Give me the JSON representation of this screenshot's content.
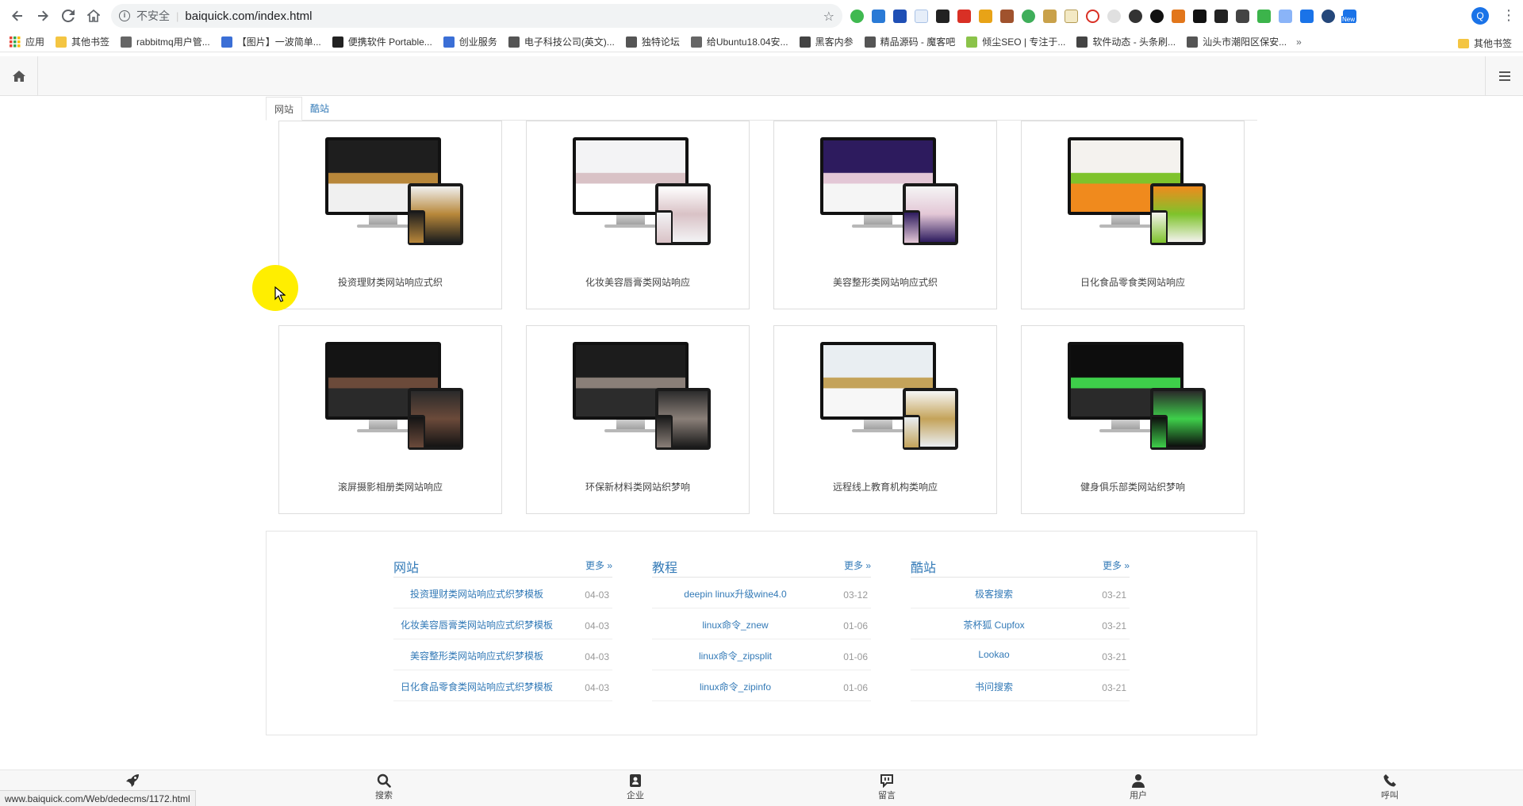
{
  "browser": {
    "insecure_label": "不安全",
    "url": "baiquick.com/index.html",
    "profile_initial": "Q",
    "ext_badge": "New"
  },
  "bookmarks": {
    "items": [
      {
        "label": "应用",
        "color": "#4285f4"
      },
      {
        "label": "其他书签",
        "color": "#f4c542"
      },
      {
        "label": "rabbitmq用户管...",
        "color": "#666666"
      },
      {
        "label": "【图片】一波简单...",
        "color": "#3b6fd6"
      },
      {
        "label": "便携软件 Portable...",
        "color": "#222222"
      },
      {
        "label": "创业服务",
        "color": "#3b6fd6"
      },
      {
        "label": "电子科技公司(英文)...",
        "color": "#555555"
      },
      {
        "label": "独特论坛",
        "color": "#555555"
      },
      {
        "label": "给Ubuntu18.04安...",
        "color": "#666666"
      },
      {
        "label": "黑客内参",
        "color": "#444444"
      },
      {
        "label": "精品源码 - 魔客吧",
        "color": "#555555"
      },
      {
        "label": "倾尘SEO | 专注于...",
        "color": "#8bc34a"
      },
      {
        "label": "软件动态 - 头条刷...",
        "color": "#444444"
      },
      {
        "label": "汕头市潮阳区保安...",
        "color": "#555555"
      }
    ],
    "overflow": "»",
    "right_folder": "其他书签"
  },
  "tabs": [
    {
      "label": "网站",
      "active": true
    },
    {
      "label": "酷站",
      "active": false
    }
  ],
  "cards": [
    {
      "title": "投资理财类网站响应式织",
      "palette": [
        "#1e1e1e",
        "#b8873a",
        "#f0f0f0"
      ]
    },
    {
      "title": "化妆美容唇膏类网站响应",
      "palette": [
        "#f3f3f5",
        "#d9c2c6",
        "#ffffff"
      ]
    },
    {
      "title": "美容整形类网站响应式织",
      "palette": [
        "#2d1b5e",
        "#e3c7d6",
        "#f5f5f5"
      ]
    },
    {
      "title": "日化食品零食类网站响应",
      "palette": [
        "#f4f2ee",
        "#7ec32b",
        "#f08a1d"
      ]
    },
    {
      "title": "滚屏摄影相册类网站响应",
      "palette": [
        "#141414",
        "#6b4a3a",
        "#2a2a2a"
      ]
    },
    {
      "title": "环保新材料类网站织梦响",
      "palette": [
        "#1c1c1c",
        "#8a7f78",
        "#2c2c2c"
      ]
    },
    {
      "title": "远程线上教育机构类响应",
      "palette": [
        "#e9eef2",
        "#c4a35a",
        "#f7f7f7"
      ]
    },
    {
      "title": "健身俱乐部类网站织梦响",
      "palette": [
        "#0d0d0d",
        "#3ecf4a",
        "#2a2a2a"
      ]
    }
  ],
  "lists": [
    {
      "title": "网站",
      "more": "更多 »",
      "items": [
        {
          "text": "投资理财类网站响应式织梦模板",
          "date": "04-03"
        },
        {
          "text": "化妆美容唇膏类网站响应式织梦模板",
          "date": "04-03"
        },
        {
          "text": "美容整形类网站响应式织梦模板",
          "date": "04-03"
        },
        {
          "text": "日化食品零食类网站响应式织梦模板",
          "date": "04-03"
        }
      ]
    },
    {
      "title": "教程",
      "more": "更多 »",
      "items": [
        {
          "text": "deepin linux升级wine4.0",
          "date": "03-12"
        },
        {
          "text": "linux命令_znew",
          "date": "01-06"
        },
        {
          "text": "linux命令_zipsplit",
          "date": "01-06"
        },
        {
          "text": "linux命令_zipinfo",
          "date": "01-06"
        }
      ]
    },
    {
      "title": "酷站",
      "more": "更多 »",
      "items": [
        {
          "text": "极客搜索",
          "date": "03-21"
        },
        {
          "text": "茶杯狐 Cupfox",
          "date": "03-21"
        },
        {
          "text": "Lookao",
          "date": "03-21"
        },
        {
          "text": "书问搜索",
          "date": "03-21"
        }
      ]
    }
  ],
  "bottom_nav": [
    {
      "label": "",
      "icon": "rocket-icon"
    },
    {
      "label": "搜索",
      "icon": "search-icon"
    },
    {
      "label": "企业",
      "icon": "contact-card-icon"
    },
    {
      "label": "留言",
      "icon": "message-icon"
    },
    {
      "label": "用户",
      "icon": "user-icon"
    },
    {
      "label": "呼叫",
      "icon": "phone-icon"
    }
  ],
  "status_bar_url": "www.baiquick.com/Web/dedecms/1172.html"
}
